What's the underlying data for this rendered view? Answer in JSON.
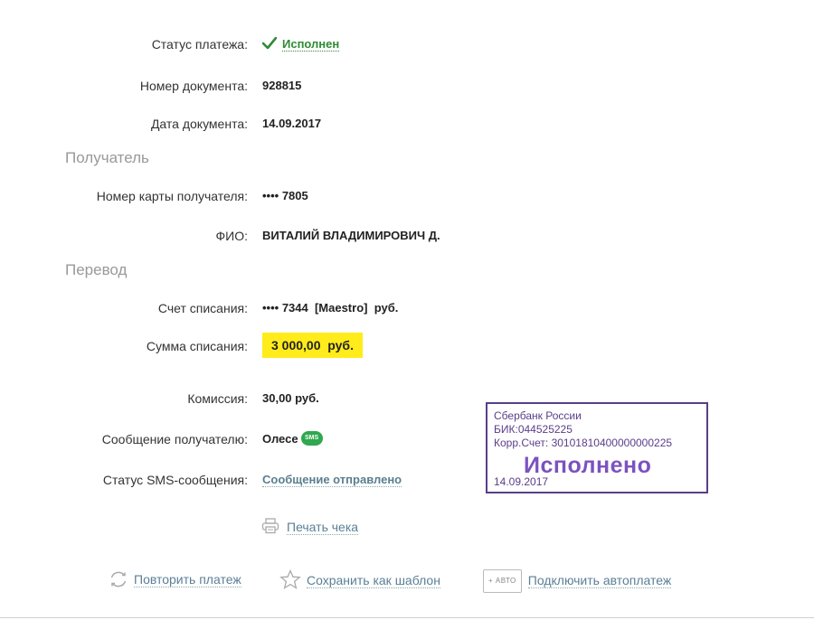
{
  "details": {
    "status_label": "Статус платежа:",
    "status_value": "Исполнен",
    "doc_number_label": "Номер документа:",
    "doc_number_value": "928815",
    "doc_date_label": "Дата документа:",
    "doc_date_value": "14.09.2017"
  },
  "recipient": {
    "section_title": "Получатель",
    "card_label": "Номер карты получателя:",
    "card_value": "•••• 7805",
    "name_label": "ФИО:",
    "name_value": "ВИТАЛИЙ ВЛАДИМИРОВИЧ Д."
  },
  "transfer": {
    "section_title": "Перевод",
    "account_label": "Счет списания:",
    "account_value": "•••• 7344  [Maestro]  руб.",
    "amount_label": "Сумма списания:",
    "amount_value": "3 000,00  руб.",
    "fee_label": "Комиссия:",
    "fee_value": "30,00 руб.",
    "message_label": "Сообщение получателю:",
    "message_value": "Олесе",
    "sms_badge": "SMS",
    "sms_status_label": "Статус SMS-сообщения:",
    "sms_status_value": "Сообщение отправлено"
  },
  "stamp": {
    "bank": "Сбербанк России",
    "bik": "БИК:044525225",
    "corr_account": "Корр.Счет: 30101810400000000225",
    "status": "Исполнено",
    "date": "14.09.2017"
  },
  "actions": {
    "print": "Печать чека",
    "repeat": "Повторить платеж",
    "save_template": "Сохранить как шаблон",
    "auto_badge": "+ АВТО",
    "autopay": "Подключить автоплатеж"
  },
  "colors": {
    "success": "#2e8b34",
    "highlight": "#ffec1a",
    "stamp": "#5b3d8a",
    "link": "#5b7f96"
  }
}
